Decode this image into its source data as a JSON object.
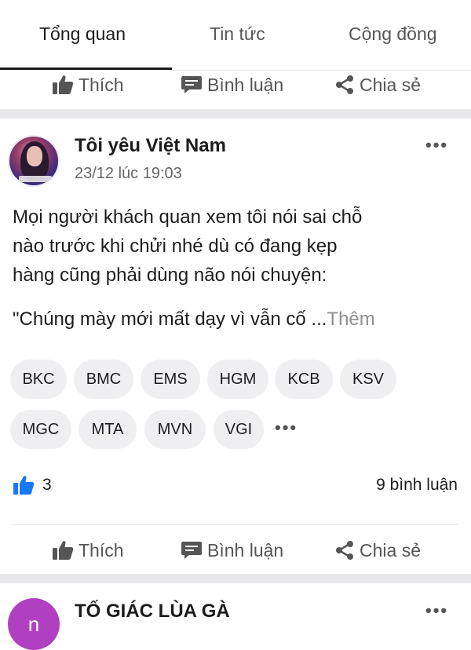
{
  "tabs": [
    {
      "label": "Tổng quan",
      "active": true
    },
    {
      "label": "Tin tức",
      "active": false
    },
    {
      "label": "Cộng đồng",
      "active": false
    }
  ],
  "actions": {
    "like": "Thích",
    "comment": "Bình luận",
    "share": "Chia sẻ"
  },
  "post": {
    "author": "Tôi yêu Việt Nam",
    "timestamp": "23/12 lúc 19:03",
    "text": "Mọi người khách quan xem tôi nói sai chỗ\nnào trước khi chửi nhé dù có đang kẹp\nhàng cũng phải dùng não nói chuyện:",
    "text_truncated": "\"Chúng mày mới mất dạy vì vẫn cố ...",
    "more_label": "Thêm",
    "tags": [
      "BKC",
      "BMC",
      "EMS",
      "HGM",
      "KCB",
      "KSV",
      "MGC",
      "MTA",
      "MVN",
      "VGI"
    ],
    "tags_more": "•••",
    "like_count": "3",
    "comment_count": "9 bình luận"
  },
  "next_post": {
    "author": "TỐ GIÁC LÙA GÀ",
    "avatar_letter": "n"
  },
  "icons": {
    "more": "•••",
    "like": "thumbs-up-icon",
    "comment": "speech-bubble-icon",
    "share": "share-icon"
  },
  "colors": {
    "like_blue": "#1877f2",
    "next_avatar": "#b13fc2"
  }
}
